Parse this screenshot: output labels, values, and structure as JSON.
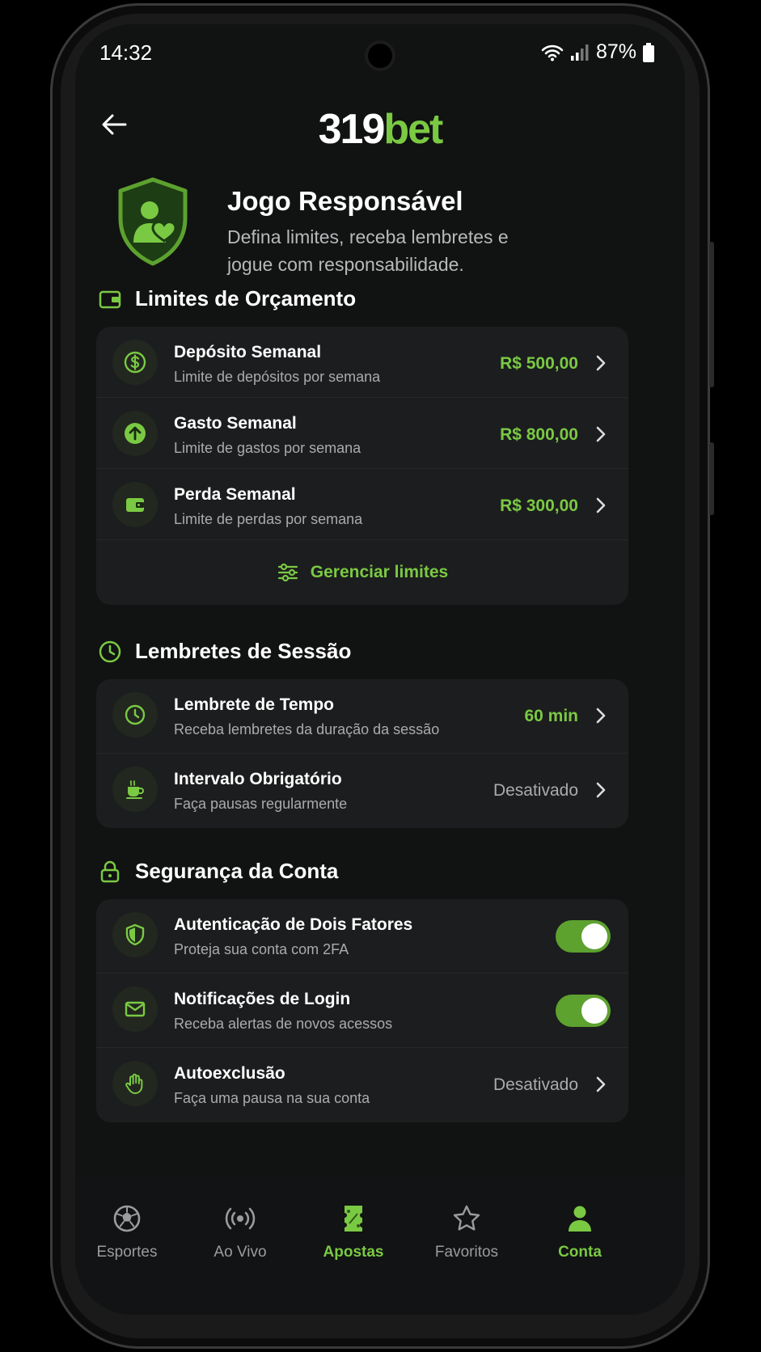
{
  "status": {
    "time": "14:32",
    "battery": "87%"
  },
  "header": {
    "logo_a": "319",
    "logo_b": "bet"
  },
  "hero": {
    "title": "Jogo Responsável",
    "subtitle": "Defina limites, receba lembretes e jogue com responsabilidade."
  },
  "budget": {
    "title": "Limites de Orçamento",
    "items": [
      {
        "label": "Depósito Semanal",
        "sub": "Limite de depósitos por semana",
        "value": "R$ 500,00"
      },
      {
        "label": "Gasto Semanal",
        "sub": "Limite de gastos por semana",
        "value": "R$ 800,00"
      },
      {
        "label": "Perda Semanal",
        "sub": "Limite de perdas por semana",
        "value": "R$ 300,00"
      }
    ],
    "manage": "Gerenciar limites"
  },
  "session": {
    "title": "Lembretes de Sessão",
    "items": [
      {
        "label": "Lembrete de Tempo",
        "sub": "Receba lembretes da duração da sessão",
        "value": "60 min"
      },
      {
        "label": "Intervalo Obrigatório",
        "sub": "Faça pausas regularmente",
        "value": "Desativado"
      }
    ]
  },
  "security": {
    "title": "Segurança da Conta",
    "items": [
      {
        "label": "Autenticação de Dois Fatores",
        "sub": "Proteja sua conta com 2FA",
        "enabled": true
      },
      {
        "label": "Notificações de Login",
        "sub": "Receba alertas de novos acessos",
        "enabled": true
      },
      {
        "label": "Autoexclusão",
        "sub": "Faça uma pausa na sua conta",
        "value": "Desativado"
      }
    ]
  },
  "nav": {
    "items": [
      {
        "label": "Esportes",
        "icon": "soccer-ball-icon"
      },
      {
        "label": "Ao Vivo",
        "icon": "live-broadcast-icon"
      },
      {
        "label": "Apostas",
        "icon": "ticket-icon"
      },
      {
        "label": "Favoritos",
        "icon": "star-icon"
      },
      {
        "label": "Conta",
        "icon": "user-icon"
      }
    ]
  },
  "colors": {
    "accent": "#7ac943",
    "background": "#111212",
    "card": "#1c1d1e"
  }
}
